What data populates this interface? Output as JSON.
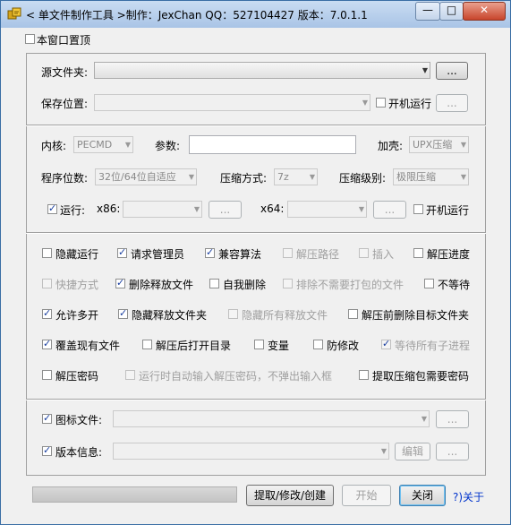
{
  "window": {
    "title": "< 单文件制作工具 >制作：JexChan  QQ：527104427  版本：7.0.1.1",
    "minimize": "—",
    "maximize": "□",
    "close": "✕"
  },
  "topmost": {
    "label": "本窗口置顶",
    "checked": false
  },
  "source": {
    "label": "源文件夹:",
    "value": "",
    "browse": "...",
    "save_label": "保存位置:",
    "save_value": "",
    "startup_label": "开机运行",
    "startup_checked": false,
    "save_browse": "..."
  },
  "core": {
    "kernel_label": "内核:",
    "kernel_value": "PECMD",
    "params_label": "参数:",
    "params_value": "",
    "shell_label": "加壳:",
    "shell_value": "UPX压缩",
    "bits_label": "程序位数:",
    "bits_value": "32位/64位自适应",
    "method_label": "压缩方式:",
    "method_value": "7z",
    "level_label": "压缩级别:",
    "level_value": "极限压缩",
    "run_label": "运行:",
    "run_checked": true,
    "x86_label": "x86:",
    "x86_value": "",
    "x86_browse": "...",
    "x64_label": "x64:",
    "x64_value": "",
    "x64_browse": "...",
    "run_startup_label": "开机运行",
    "run_startup_checked": false
  },
  "options": {
    "hide_run": "隐藏运行",
    "request_admin": "请求管理员",
    "compat": "兼容算法",
    "extract_path": "解压路径",
    "insert": "插入",
    "extract_progress": "解压进度",
    "shortcut": "快捷方式",
    "delete_released": "删除释放文件",
    "self_delete": "自我删除",
    "exclude_files": "排除不需要打包的文件",
    "no_wait": "不等待",
    "allow_multi": "允许多开",
    "hide_released_folder": "隐藏释放文件夹",
    "hide_all_released": "隐藏所有释放文件",
    "delete_target_folder": "解压前删除目标文件夹",
    "overwrite": "覆盖现有文件",
    "open_after": "解压后打开目录",
    "variable": "变量",
    "anti_modify": "防修改",
    "wait_children": "等待所有子进程",
    "extract_password": "解压密码",
    "auto_password": "运行时自动输入解压密码，不弹出输入框",
    "extract_need_password": "提取压缩包需要密码"
  },
  "resources": {
    "icon_label": "图标文件:",
    "icon_checked": true,
    "icon_value": "",
    "icon_browse": "...",
    "version_label": "版本信息:",
    "version_checked": true,
    "version_value": "",
    "edit": "编辑",
    "version_browse": "..."
  },
  "footer": {
    "progress": 0,
    "extract": "提取/修改/创建",
    "start": "开始",
    "close": "关闭",
    "about": "?)关于"
  }
}
